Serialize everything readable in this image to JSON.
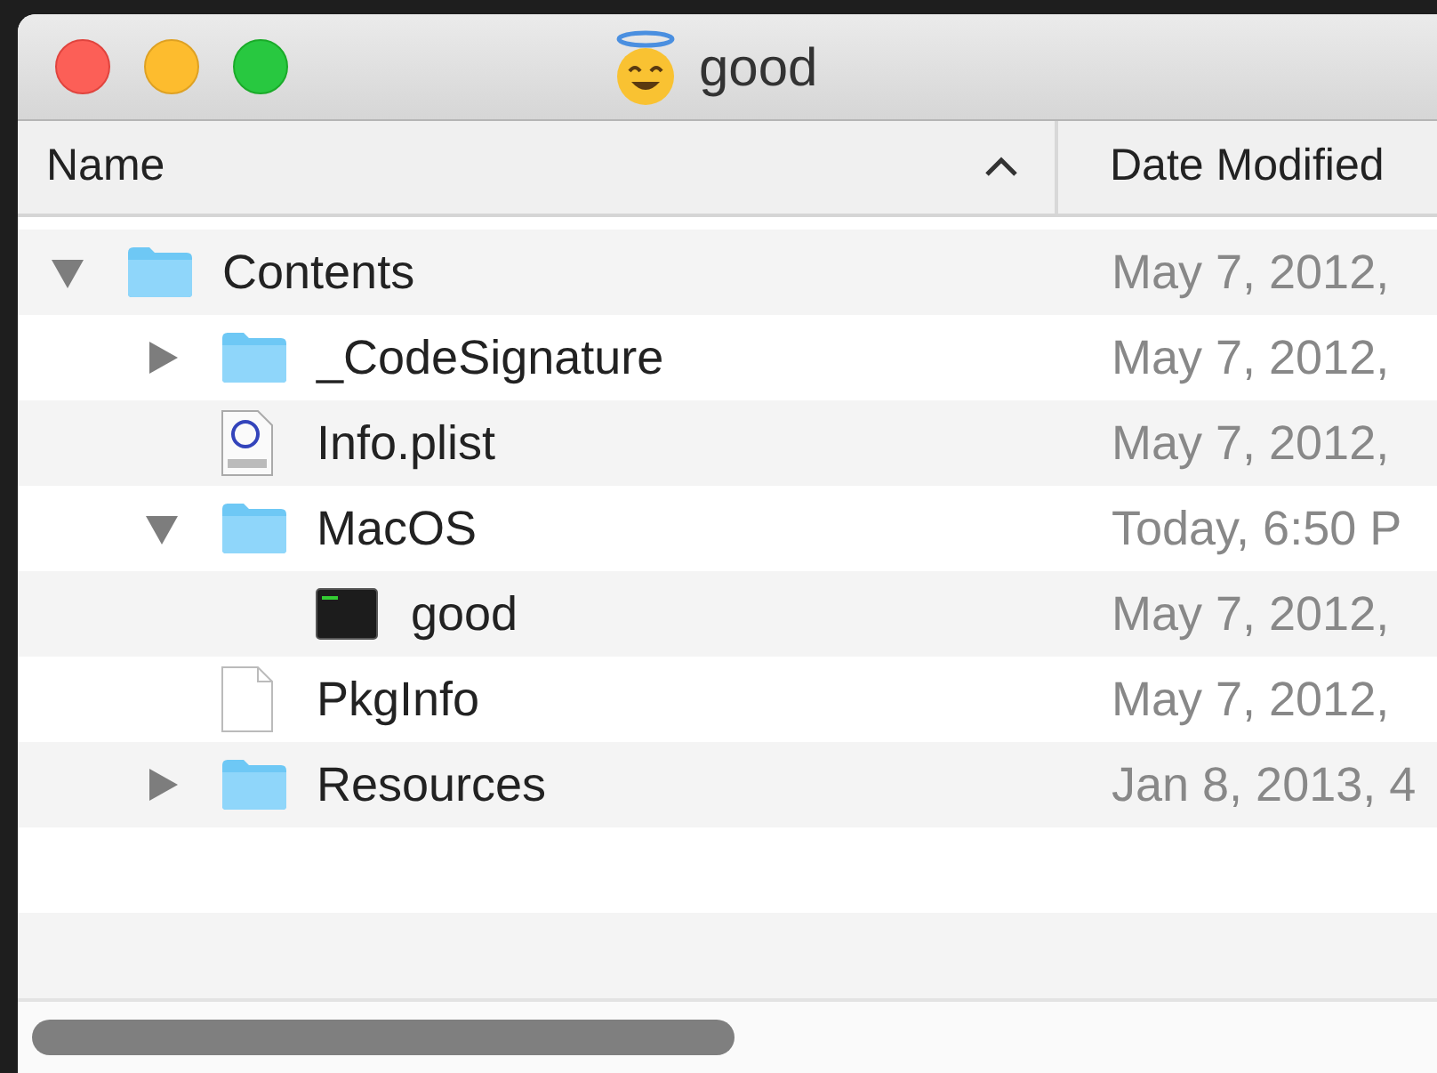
{
  "window": {
    "title": "good"
  },
  "columns": [
    {
      "label": "Name",
      "sorted_ascending": true
    },
    {
      "label": "Date Modified"
    }
  ],
  "tree": [
    {
      "kind": "folder",
      "name": "Contents",
      "date": "May 7, 2012,",
      "expanded": true,
      "children": [
        {
          "kind": "folder",
          "name": "_CodeSignature",
          "date": "May 7, 2012,",
          "expanded": false
        },
        {
          "kind": "plist",
          "name": "Info.plist",
          "date": "May 7, 2012,"
        },
        {
          "kind": "folder",
          "name": "MacOS",
          "date": "Today, 6:50 P",
          "expanded": true,
          "children": [
            {
              "kind": "executable",
              "name": "good",
              "date": "May 7, 2012,"
            }
          ]
        },
        {
          "kind": "file",
          "name": "PkgInfo",
          "date": "May 7, 2012,"
        },
        {
          "kind": "folder",
          "name": "Resources",
          "date": "Jan 8, 2013, 4",
          "expanded": false
        }
      ]
    }
  ]
}
